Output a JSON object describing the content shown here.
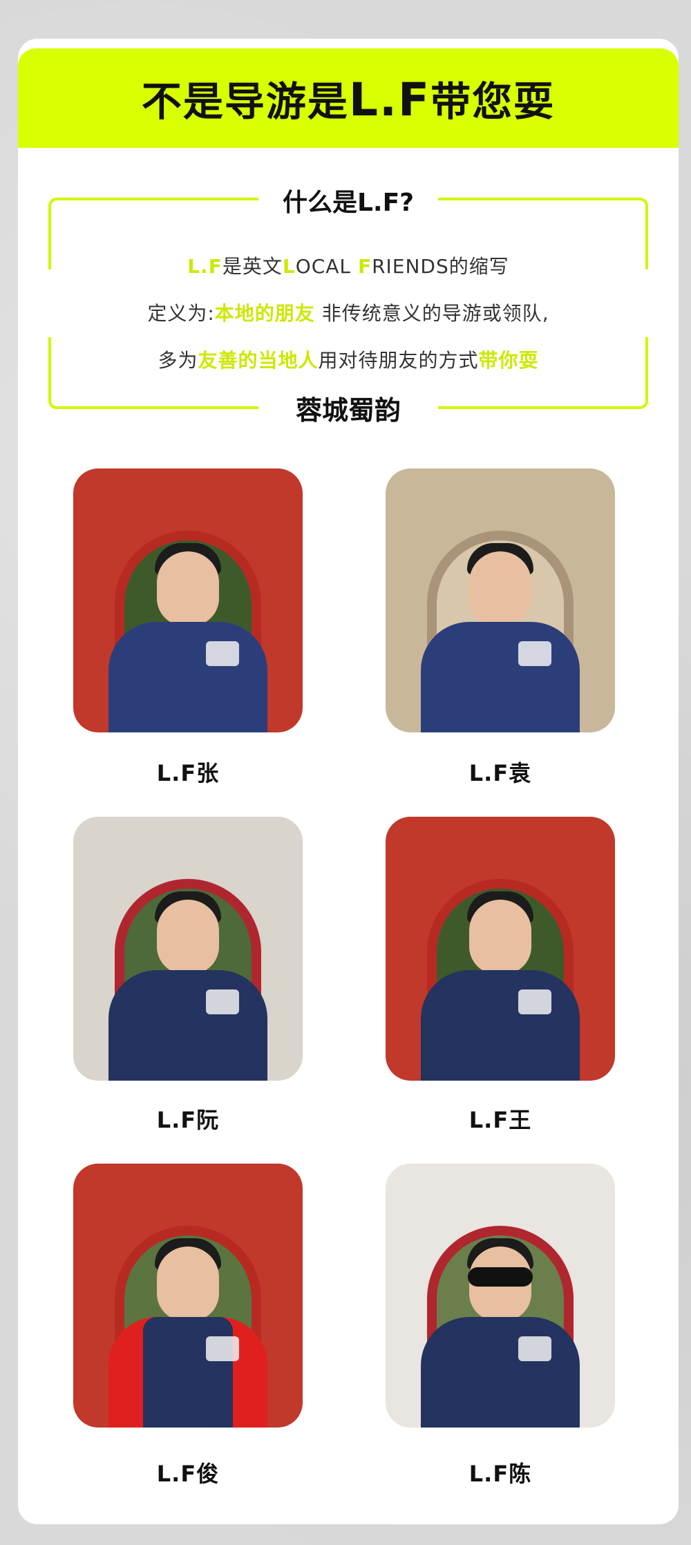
{
  "header": {
    "title_prefix": "不是导游是",
    "title_lf": "L.F",
    "title_suffix": "带您耍"
  },
  "intro": {
    "question": "什么是L.F?",
    "line1": {
      "hl1": "L.F",
      "t1": "是英文",
      "hl2": "L",
      "t2": "OCAL ",
      "hl3": "F",
      "t3": "RIENDS的缩写"
    },
    "line2": {
      "t1": "定义为:",
      "hl1": "本地的朋友",
      "t2": " 非传统意义的导游或领队,"
    },
    "line3": {
      "t1": "多为",
      "hl1": "友善的当地人",
      "t2": "用对待朋友的方式",
      "hl2": "带你耍"
    },
    "brand": "蓉城蜀韵"
  },
  "guides": [
    {
      "name": "L.F张"
    },
    {
      "name": "L.F袁"
    },
    {
      "name": "L.F阮"
    },
    {
      "name": "L.F王"
    },
    {
      "name": "L.F俊"
    },
    {
      "name": "L.F陈"
    }
  ],
  "colors": {
    "accent": "#d9ff00",
    "text": "#111111",
    "vest": "#2c3e7a",
    "wall": "#c0392b"
  }
}
